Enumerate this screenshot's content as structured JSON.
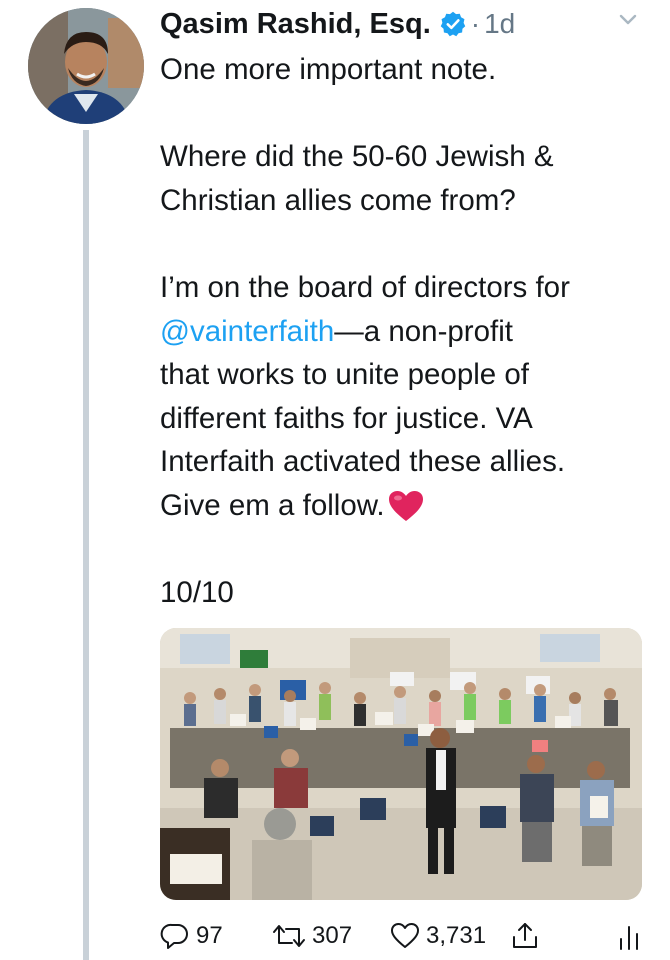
{
  "tweet": {
    "author_name": "Qasim Rashid, Esq.",
    "separator": "·",
    "time": "1d",
    "verified_icon": "verified-badge-icon",
    "menu_icon": "chevron-down-icon",
    "lines": {
      "l1": "One more important note.",
      "l2": "Where did the 50-60 Jewish &",
      "l3": "Christian allies come from?",
      "l4": "I’m on the board of directors for",
      "l5_mention": "@vainterfaith",
      "l5_rest": "—a non-profit",
      "l6": "that works to unite people of",
      "l7": "different faiths for justice. VA",
      "l8": "Interfaith activated these allies.",
      "l9": "Give em a follow.",
      "l10": "10/10"
    },
    "emoji": "heart-emoji",
    "photo_alt": "Photo of a crowded meeting room with people holding signs",
    "actions": {
      "reply_count": "97",
      "retweet_count": "307",
      "like_count": "3,731"
    }
  },
  "colors": {
    "link": "#1da1f2",
    "secondary_text": "#657786",
    "thread_line": "#c9d1d8",
    "heart": "#e0245e"
  }
}
